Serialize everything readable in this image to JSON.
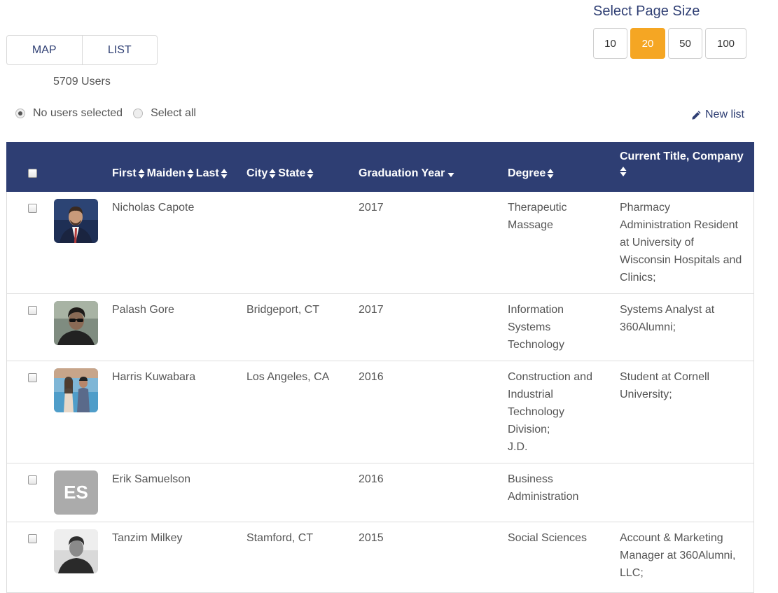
{
  "view_toggle": {
    "map_label": "MAP",
    "list_label": "LIST"
  },
  "user_count": "5709 Users",
  "page_size": {
    "title": "Select Page Size",
    "options": [
      "10",
      "20",
      "50",
      "100"
    ],
    "selected": "20",
    "active_color": "#f5a623"
  },
  "selection": {
    "none_label": "No users selected",
    "all_label": "Select all"
  },
  "new_list_label": "New list",
  "table": {
    "header_color": "#2e3e73",
    "columns": {
      "first": "First",
      "maiden": "Maiden",
      "last": "Last",
      "city": "City",
      "state": "State",
      "grad_year": "Graduation Year",
      "degree": "Degree",
      "title_company": "Current Title, Company"
    },
    "rows": [
      {
        "name": "Nicholas Capote",
        "location": "",
        "year": "2017",
        "degree": [
          "Therapeutic",
          "Massage"
        ],
        "title": [
          "Pharmacy",
          "Administration Resident",
          "at University of",
          "Wisconsin Hospitals and",
          "Clinics;"
        ],
        "avatar": "photo-suit"
      },
      {
        "name": "Palash Gore",
        "location": "Bridgeport, CT",
        "year": "2017",
        "degree": [
          "Information",
          "Systems",
          "Technology"
        ],
        "title": [
          "Systems Analyst at",
          "360Alumni;"
        ],
        "avatar": "photo-sunglasses"
      },
      {
        "name": "Harris Kuwabara",
        "location": "Los Angeles, CA",
        "year": "2016",
        "degree": [
          "Construction and",
          "Industrial",
          "Technology",
          "Division;",
          "J.D."
        ],
        "title": [
          "Student at Cornell",
          "University;"
        ],
        "avatar": "photo-couple"
      },
      {
        "name": "Erik Samuelson",
        "location": "",
        "year": "2016",
        "degree": [
          "Business",
          "Administration"
        ],
        "title": [],
        "avatar_initials": "ES"
      },
      {
        "name": "Tanzim Milkey",
        "location": "Stamford, CT",
        "year": "2015",
        "degree": [
          "Social Sciences"
        ],
        "title": [
          "Account & Marketing",
          "Manager at 360Alumni,",
          "LLC;"
        ],
        "avatar": "photo-bw"
      }
    ]
  }
}
